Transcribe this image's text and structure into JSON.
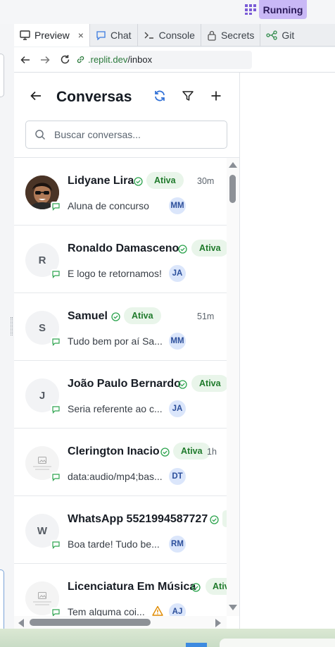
{
  "topbar": {
    "run_label": "Running"
  },
  "tabs": [
    {
      "label": "Preview",
      "icon": "monitor-icon",
      "active": true
    },
    {
      "label": "Chat",
      "icon": "chat-icon"
    },
    {
      "label": "Console",
      "icon": "terminal-icon"
    },
    {
      "label": "Secrets",
      "icon": "lock-icon"
    },
    {
      "label": "Git",
      "icon": "git-icon"
    }
  ],
  "urlbar": {
    "host": ".replit.dev",
    "path": "/inbox"
  },
  "app": {
    "title": "Conversas",
    "search_placeholder": "Buscar conversas..."
  },
  "conversations": [
    {
      "name": "Lidyane Lira",
      "status": "Ativa",
      "time": "30m",
      "preview": "Aluna de concurso",
      "agent": "MM",
      "avatar": "photo"
    },
    {
      "name": "Ronaldo Damasceno",
      "status": "Ativa",
      "time": "",
      "preview": "E logo te retornamos!",
      "agent": "JA",
      "avatar": "R"
    },
    {
      "name": "Samuel",
      "status": "Ativa",
      "time": "51m",
      "preview": "Tudo bem por aí Sa...",
      "agent": "MM",
      "avatar": "S"
    },
    {
      "name": "João Paulo Bernardo",
      "status": "Ativa",
      "time": "",
      "preview": "Seria referente ao c...",
      "agent": "JA",
      "avatar": "J"
    },
    {
      "name": "Clerington Inacio",
      "status": "Ativa",
      "time": "1h",
      "preview": "data:audio/mp4;bas...",
      "agent": "DT",
      "avatar": "image"
    },
    {
      "name": "WhatsApp 5521994587727",
      "status": "",
      "time": "",
      "preview": "Boa tarde! Tudo be...",
      "agent": "RM",
      "avatar": "W"
    },
    {
      "name": "Licenciatura Em Música",
      "status": "Ativ",
      "time": "",
      "preview": "Tem alguma coi...",
      "agent": "AJ",
      "avatar": "image",
      "warning": true
    }
  ],
  "colors": {
    "accent": "#2f6fd6",
    "status_bg": "#e9f5ea",
    "status_text": "#1f7a2b",
    "run_bg": "#c9b8f6"
  }
}
